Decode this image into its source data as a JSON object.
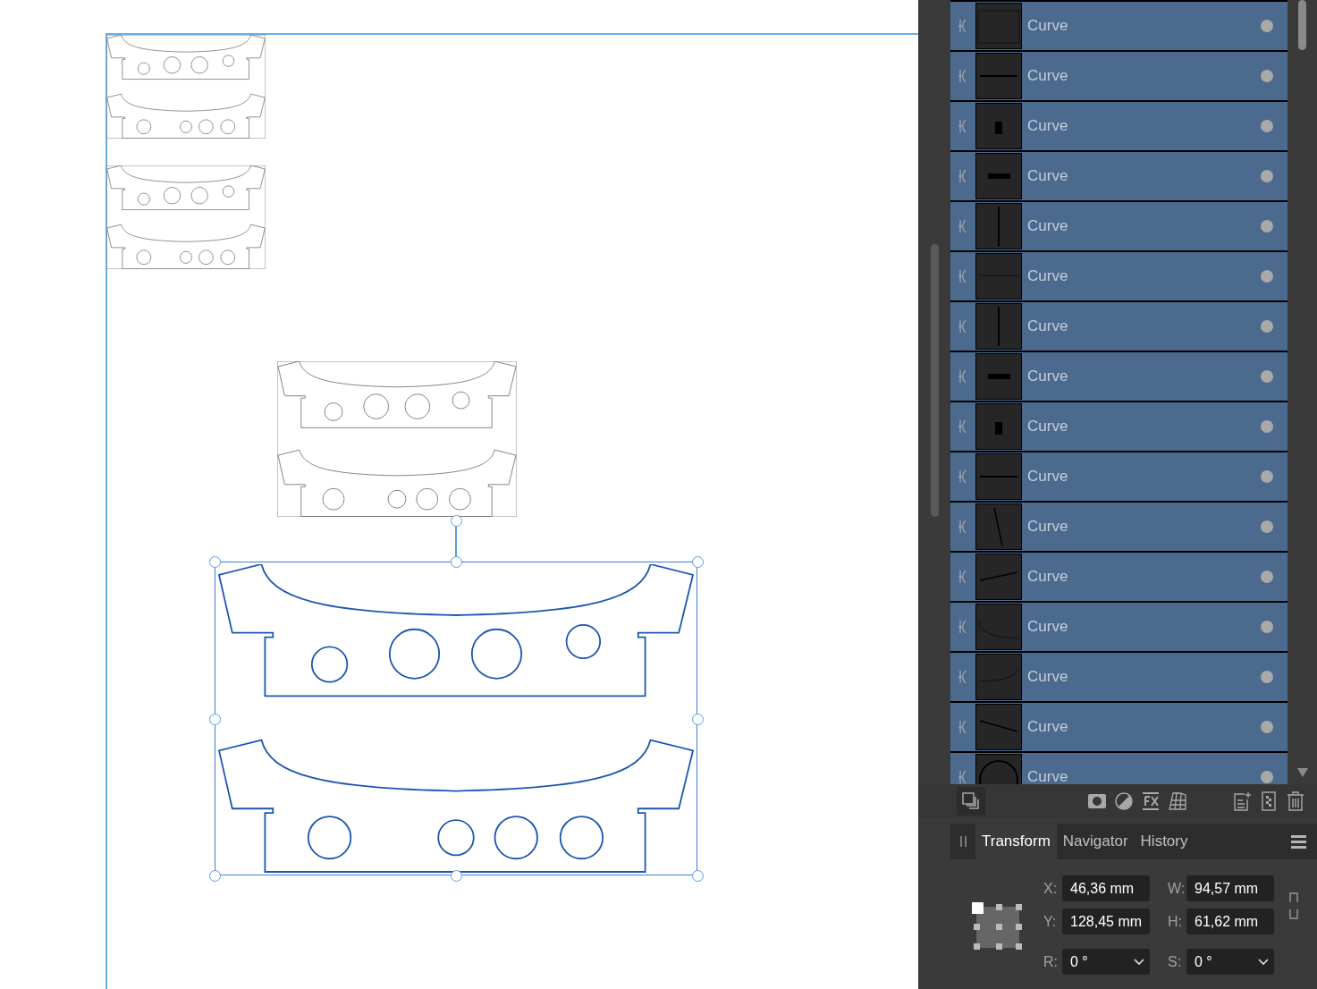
{
  "layers": [
    {
      "name": "Curve",
      "selected": true,
      "kind": "frame"
    },
    {
      "name": "Curve",
      "selected": true,
      "kind": "hline"
    },
    {
      "name": "Curve",
      "selected": true,
      "kind": "block"
    },
    {
      "name": "Curve",
      "selected": true,
      "kind": "bar"
    },
    {
      "name": "Curve",
      "selected": true,
      "kind": "vline"
    },
    {
      "name": "Curve",
      "selected": true,
      "kind": "topline"
    },
    {
      "name": "Curve",
      "selected": true,
      "kind": "vline"
    },
    {
      "name": "Curve",
      "selected": true,
      "kind": "bar"
    },
    {
      "name": "Curve",
      "selected": true,
      "kind": "block"
    },
    {
      "name": "Curve",
      "selected": true,
      "kind": "hline"
    },
    {
      "name": "Curve",
      "selected": true,
      "kind": "steep"
    },
    {
      "name": "Curve",
      "selected": true,
      "kind": "slope"
    },
    {
      "name": "Curve",
      "selected": true,
      "kind": "bendleft"
    },
    {
      "name": "Curve",
      "selected": true,
      "kind": "bendright"
    },
    {
      "name": "Curve",
      "selected": true,
      "kind": "fall"
    },
    {
      "name": "Curve",
      "selected": true,
      "kind": "circle"
    }
  ],
  "panel_tabs": [
    {
      "label": "Transform",
      "selected": true
    },
    {
      "label": "Navigator",
      "selected": false
    },
    {
      "label": "History",
      "selected": false
    }
  ],
  "transform": {
    "left": [
      {
        "label": "X:",
        "value": "46,36 mm",
        "kind": "text"
      },
      {
        "label": "Y:",
        "value": "128,45 mm",
        "kind": "text"
      },
      {
        "label": "R:",
        "value": "0 °",
        "kind": "select"
      }
    ],
    "right": [
      {
        "label": "W:",
        "value": "94,57 mm",
        "kind": "text"
      },
      {
        "label": "H:",
        "value": "61,62 mm",
        "kind": "text"
      },
      {
        "label": "S:",
        "value": "0 °",
        "kind": "select"
      }
    ]
  }
}
